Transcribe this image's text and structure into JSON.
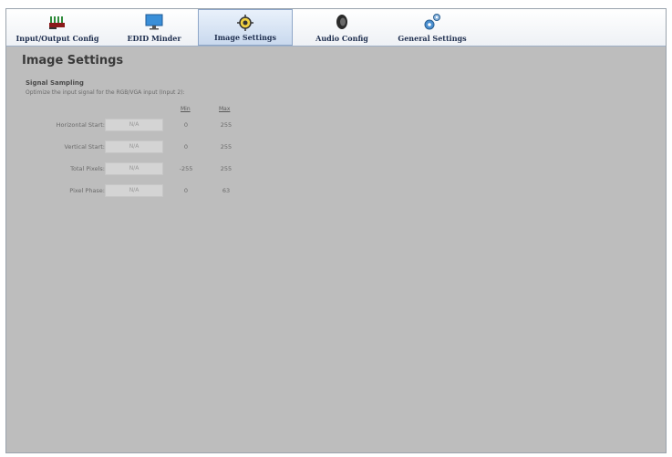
{
  "tabs": [
    {
      "label": "Input/Output Config",
      "icon": "io-connector-icon"
    },
    {
      "label": "EDID Minder",
      "icon": "monitor-icon"
    },
    {
      "label": "Image Settings",
      "icon": "image-settings-icon",
      "active": true
    },
    {
      "label": "Audio Config",
      "icon": "speaker-icon"
    },
    {
      "label": "General Settings",
      "icon": "gears-icon"
    }
  ],
  "page": {
    "title": "Image Settings"
  },
  "section": {
    "title": "Signal Sampling",
    "description": "Optimize the input signal for the RGB/VGA input (Input 2):",
    "min_header": "Min",
    "max_header": "Max"
  },
  "rows": [
    {
      "label": "Horizontal Start:",
      "value": "N/A",
      "min": "0",
      "max": "255"
    },
    {
      "label": "Vertical Start:",
      "value": "N/A",
      "min": "0",
      "max": "255"
    },
    {
      "label": "Total Pixels:",
      "value": "N/A",
      "min": "-255",
      "max": "255"
    },
    {
      "label": "Pixel Phase:",
      "value": "N/A",
      "min": "0",
      "max": "63"
    }
  ],
  "colors": {
    "background": "#bdbdbd",
    "toolbar": "#eef1f5",
    "active_tab": "#c9d9ee"
  }
}
